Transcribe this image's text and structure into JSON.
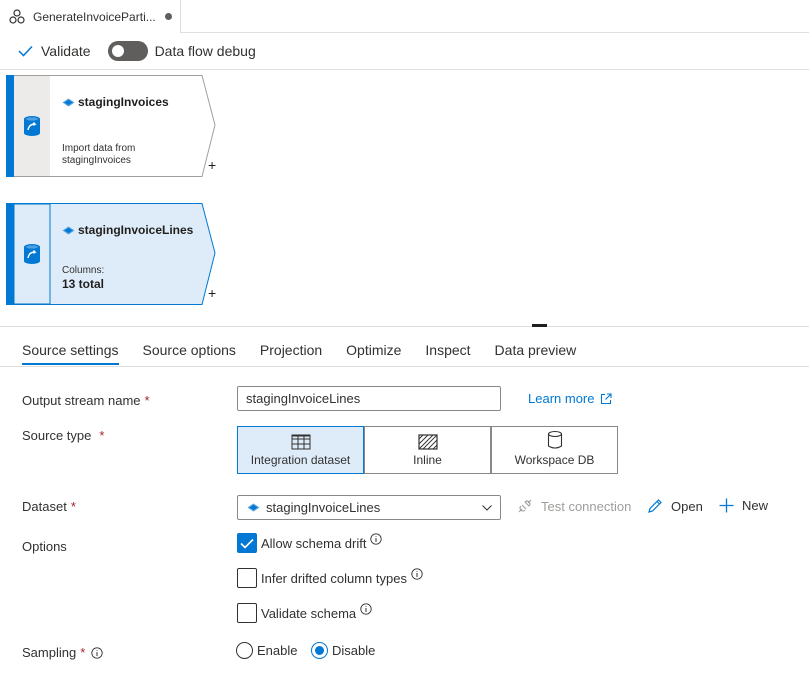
{
  "tab": {
    "title": "GenerateInvoiceParti..."
  },
  "commands": {
    "validate": "Validate",
    "debug_label": "Data flow debug",
    "debug_on": false
  },
  "nodes": [
    {
      "title": "stagingInvoices",
      "desc1": "Import data from",
      "desc2": "stagingInvoices",
      "plus": "+"
    },
    {
      "title": "stagingInvoiceLines",
      "desc1": "Columns:",
      "count": "13 total",
      "plus": "+"
    }
  ],
  "panel_tabs": [
    "Source settings",
    "Source options",
    "Projection",
    "Optimize",
    "Inspect",
    "Data preview"
  ],
  "form": {
    "output_stream_label": "Output stream name",
    "output_stream_value": "stagingInvoiceLines",
    "required_mark": "*",
    "learn_more": "Learn more",
    "source_type_label": "Source type",
    "source_types": [
      "Integration dataset",
      "Inline",
      "Workspace DB"
    ],
    "source_type_selected": "Integration dataset",
    "dataset_label": "Dataset",
    "dataset_value": "stagingInvoiceLines",
    "test_connection": "Test connection",
    "open": "Open",
    "new": "New",
    "options_label": "Options",
    "options": [
      {
        "label": "Allow schema drift",
        "checked": true
      },
      {
        "label": "Infer drifted column types",
        "checked": false
      },
      {
        "label": "Validate schema",
        "checked": false
      }
    ],
    "sampling_label": "Sampling",
    "sampling_options": [
      "Enable",
      "Disable"
    ],
    "sampling_selected": "Disable"
  },
  "colors": {
    "accent": "#0078d4",
    "selected_node_bg": "#deecf9",
    "required": "#a4262c"
  }
}
